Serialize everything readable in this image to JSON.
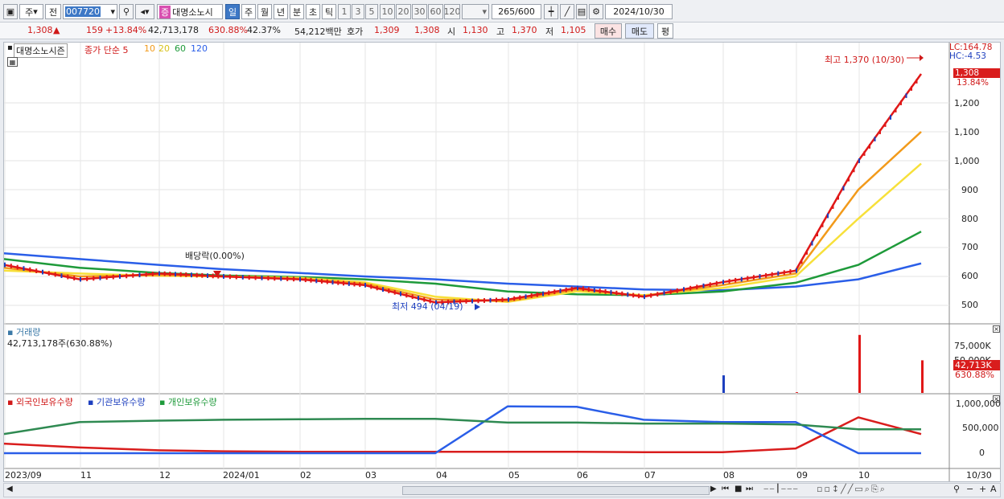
{
  "toolbar": {
    "period_label": "주",
    "prev_label": "전",
    "code": "007720",
    "stock_name": "대명소노시",
    "stock_tag": "증",
    "intervals": [
      "일",
      "주",
      "월",
      "년",
      "분",
      "초",
      "틱"
    ],
    "numbers": [
      "1",
      "3",
      "5",
      "10",
      "20",
      "30",
      "60",
      "120"
    ],
    "count": "265",
    "count_total": "/600",
    "date": "2024/10/30"
  },
  "quote": {
    "price": "1,308",
    "arrow": "▲",
    "change": "159",
    "change_pct": "+13.84%",
    "volume": "42,713,178",
    "vol_ratio": "630.88%",
    "turnover": "42.37%",
    "amount": "54,212백만",
    "bid_label": "호가",
    "bid1": "1,309",
    "bid2": "1,308",
    "open_label": "시",
    "open": "1,130",
    "high_label": "고",
    "high": "1,370",
    "low_label": "저",
    "low": "1,105",
    "buy_label": "매수",
    "sell_label": "매도",
    "eval_label": "평"
  },
  "price_panel": {
    "legend_name": "대명소노시즌",
    "legend_close": "종가 단순 5",
    "ma_labels": [
      "10",
      "20",
      "60",
      "120"
    ],
    "lc": "LC:164.78",
    "hc": "HC:-4.53",
    "last_price": "1,308",
    "last_pct": "13.84%",
    "high_annot": "최고 1,370 (10/30)",
    "low_annot": "최저 494 (04/19)",
    "div_annot": "배당락(0.00%)",
    "yticks": [
      "1,200",
      "1,100",
      "1,000",
      "900",
      "800",
      "700",
      "600",
      "500"
    ]
  },
  "volume_panel": {
    "title": "거래량",
    "value": "42,713,178주(630.88%)",
    "yticks": [
      "75,000K",
      "50,000K"
    ],
    "last_value": "42,713K",
    "last_pct": "630.88%"
  },
  "holder_panel": {
    "legend": [
      "외국인보유수량",
      "기관보유수량",
      "개인보유수량"
    ],
    "yticks": [
      "1,000,000",
      "500,000",
      "0"
    ]
  },
  "xaxis": [
    "2023/09",
    "11",
    "12",
    "2024/01",
    "02",
    "03",
    "04",
    "05",
    "06",
    "07",
    "08",
    "09",
    "10",
    "10/30"
  ],
  "colors": {
    "ma5": "#e01818",
    "ma10": "#f29a1a",
    "ma20": "#f7e03a",
    "ma60": "#1e9a3a",
    "ma120": "#2a5ee8",
    "up": "#e01818",
    "down": "#1d3fbf"
  },
  "chart_data": [
    {
      "type": "line",
      "title": "대명소노시즌",
      "x": [
        "2023/09",
        "11",
        "12",
        "2024/01",
        "02",
        "03",
        "04",
        "05",
        "06",
        "07",
        "08",
        "09",
        "10",
        "10/30"
      ],
      "series": [
        {
          "name": "5",
          "values": [
            640,
            590,
            610,
            600,
            590,
            570,
            510,
            520,
            560,
            530,
            580,
            620,
            1000,
            1300
          ]
        },
        {
          "name": "10",
          "values": [
            630,
            600,
            605,
            600,
            592,
            575,
            520,
            515,
            555,
            532,
            570,
            610,
            900,
            1100
          ]
        },
        {
          "name": "20",
          "values": [
            620,
            610,
            602,
            600,
            595,
            580,
            530,
            512,
            548,
            535,
            560,
            600,
            800,
            990
          ]
        },
        {
          "name": "60",
          "values": [
            660,
            630,
            612,
            603,
            598,
            590,
            575,
            548,
            538,
            535,
            548,
            578,
            640,
            755
          ]
        },
        {
          "name": "120",
          "values": [
            680,
            660,
            640,
            625,
            612,
            600,
            590,
            575,
            565,
            555,
            552,
            565,
            590,
            645
          ]
        }
      ],
      "ylim": [
        450,
        1400
      ]
    },
    {
      "type": "bar",
      "title": "거래량",
      "categories": [
        "08",
        "09",
        "10",
        "10/30"
      ],
      "values": [
        23000,
        1000,
        76000,
        42713
      ]
    },
    {
      "type": "line",
      "x": [
        "2023/09",
        "11",
        "12",
        "2024/01",
        "02",
        "03",
        "04",
        "05",
        "06",
        "07",
        "08",
        "09",
        "10",
        "10/30"
      ],
      "series": [
        {
          "name": "외국인보유수량",
          "values": [
            200000,
            120000,
            60000,
            40000,
            30000,
            30000,
            30000,
            30000,
            30000,
            20000,
            20000,
            100000,
            750000,
            400000
          ]
        },
        {
          "name": "기관보유수량",
          "values": [
            0,
            0,
            0,
            0,
            0,
            0,
            0,
            980000,
            970000,
            700000,
            650000,
            650000,
            0,
            0
          ]
        },
        {
          "name": "개인보유수량",
          "values": [
            400000,
            650000,
            680000,
            700000,
            710000,
            720000,
            720000,
            640000,
            640000,
            620000,
            620000,
            600000,
            500000,
            500000
          ]
        }
      ],
      "ylim": [
        -200000,
        1100000
      ]
    }
  ]
}
